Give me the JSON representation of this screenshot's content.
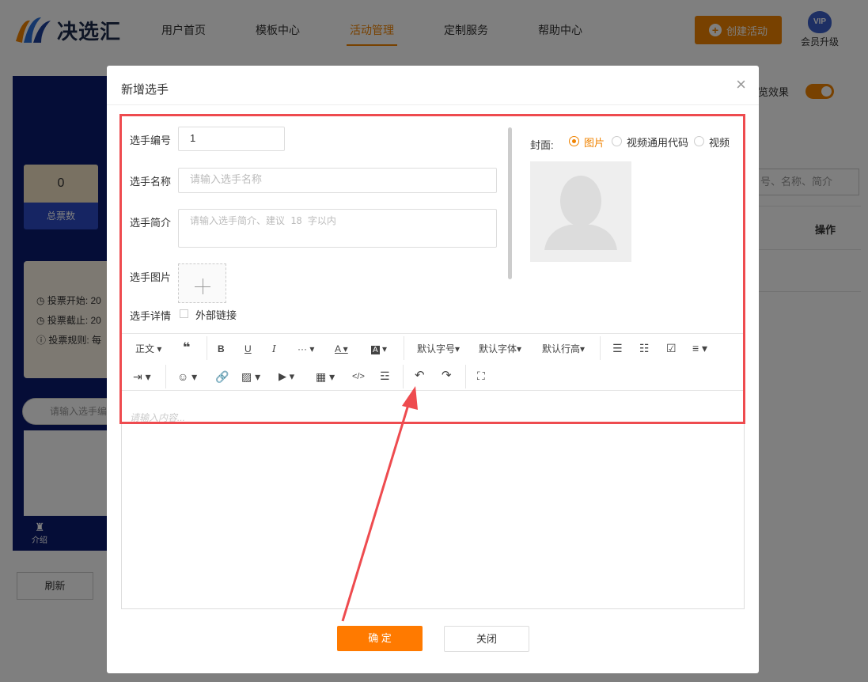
{
  "header": {
    "logo_text": "决选汇",
    "nav": [
      "用户首页",
      "模板中心",
      "活动管理",
      "定制服务",
      "帮助中心"
    ],
    "active_nav": "活动管理",
    "create_button": "创建活动",
    "vip_badge": "VIP",
    "vip_label": "会员升级"
  },
  "background": {
    "stat_value": "0",
    "stat_label": "总票数",
    "info": [
      "投票开始: 20",
      "投票截止: 20",
      "投票规则: 每"
    ],
    "search_placeholder": "请输入选手编",
    "tab_label": "介绍",
    "refresh_button": "刷新",
    "preview_label": "览效果",
    "right_search": "号、名称、简介",
    "col_header": "操作"
  },
  "modal": {
    "title": "新增选手",
    "close_icon": "×",
    "fields": {
      "number_label": "选手编号",
      "number_value": "1",
      "name_label": "选手名称",
      "name_placeholder": "请输入选手名称",
      "intro_label": "选手简介",
      "intro_placeholder": "请输入选手简介、建议 18 字以内",
      "image_label": "选手图片",
      "detail_label": "选手详情",
      "external_link_label": "外部链接"
    },
    "cover": {
      "label": "封面:",
      "options": [
        "图片",
        "视频通用代码",
        "视频"
      ],
      "selected": "图片"
    },
    "toolbar": {
      "paragraph": "正文",
      "font_size": "默认字号",
      "font_family": "默认字体",
      "line_height": "默认行高"
    },
    "editor_placeholder": "请输入内容...",
    "ok_button": "确 定",
    "close_button": "关闭"
  },
  "colors": {
    "accent": "#f08300",
    "highlight_box": "#ee4b4f"
  }
}
